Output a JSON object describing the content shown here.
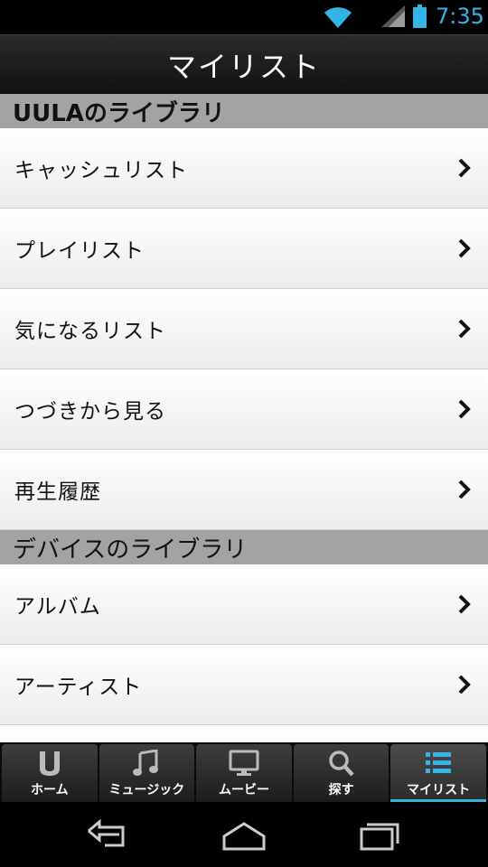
{
  "status_bar": {
    "time": "7:35",
    "accent_color": "#33b5e5",
    "icons": [
      "wifi-icon",
      "signal-icon",
      "battery-icon"
    ]
  },
  "header": {
    "title": "マイリスト"
  },
  "sections": [
    {
      "title": "UULAのライブラリ",
      "items": [
        {
          "label": "キャッシュリスト"
        },
        {
          "label": "プレイリスト"
        },
        {
          "label": "気になるリスト"
        },
        {
          "label": "つづきから見る"
        },
        {
          "label": "再生履歴"
        }
      ]
    },
    {
      "title": "デバイスのライブラリ",
      "items": [
        {
          "label": "アルバム"
        },
        {
          "label": "アーティスト"
        }
      ]
    }
  ],
  "tabs": [
    {
      "label": "ホーム",
      "icon": "uula-logo-icon"
    },
    {
      "label": "ミュージック",
      "icon": "music-note-icon"
    },
    {
      "label": "ムービー",
      "icon": "monitor-icon"
    },
    {
      "label": "探す",
      "icon": "search-icon"
    },
    {
      "label": "マイリスト",
      "icon": "list-icon",
      "active": true
    }
  ],
  "nav_bar": {
    "buttons": [
      "back-icon",
      "home-icon",
      "recent-apps-icon"
    ]
  }
}
